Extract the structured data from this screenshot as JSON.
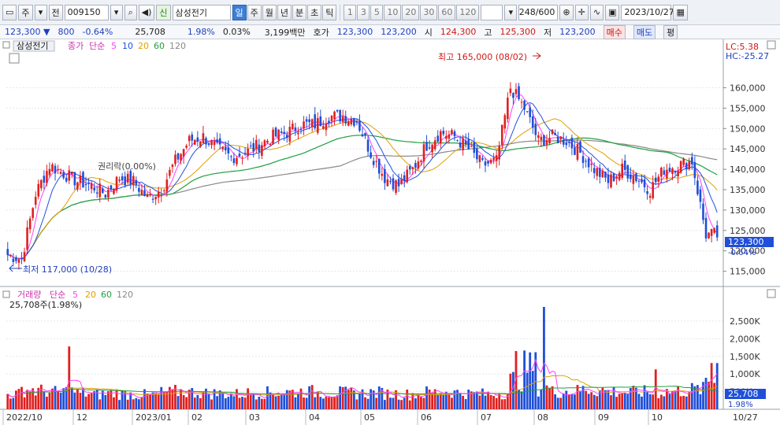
{
  "toolbar": {
    "market": "주",
    "period_prefix": "전",
    "stock_code": "009150",
    "credit_badge": "신",
    "stock_name": "삼성전기",
    "timeframes": [
      "일",
      "주",
      "월",
      "년",
      "분",
      "초",
      "틱"
    ],
    "active_timeframe": "일",
    "minute_options": [
      "1",
      "3",
      "5",
      "10",
      "20",
      "30",
      "60",
      "120"
    ],
    "count_display": "248/600",
    "date": "2023/10/27"
  },
  "quote": {
    "price": "123,300",
    "change_arrow": "▼",
    "change": "800",
    "change_pct": "-0.64%",
    "volume": "25,708",
    "volume_pct": "1.98%",
    "turnover": "0.03%",
    "amount": "3,199백만",
    "ask_label": "호가",
    "ask": "123,300",
    "bid": "123,200",
    "open_label": "시",
    "open": "124,300",
    "high_label": "고",
    "high": "125,300",
    "low_label": "저",
    "low": "123,200",
    "buy_label": "매수",
    "sell_label": "매도",
    "eval_label": "평"
  },
  "price_panel": {
    "title": "삼성전기",
    "ma_prefix": "종가",
    "ma_type": "단순",
    "ma_periods": [
      "5",
      "10",
      "20",
      "60",
      "120"
    ],
    "hl_high_label": "LC:5.38",
    "hl_low_label": "HC:-25.27",
    "annot_high": "최고 165,000 (08/02)",
    "annot_low": "최저 117,000 (10/28)",
    "annot_mid": "권리락(0.00%)",
    "last_price": "123,300",
    "last_pct": "-0.64%"
  },
  "volume_panel": {
    "title": "거래량",
    "ma_type": "단순",
    "ma_periods": [
      "5",
      "20",
      "60",
      "120"
    ],
    "current": "25,708주(1.98%)",
    "last_value": "25,708",
    "last_pct": "1.98%"
  },
  "colors": {
    "up": "#e02020",
    "down": "#1f4fd8",
    "ma5": "#ff40ff",
    "ma10": "#2050e0",
    "ma20": "#e0a000",
    "ma60": "#20a040",
    "ma120": "#888888"
  },
  "chart_data": {
    "type": "candlestick",
    "y_ticks": [
      "160,000",
      "155,000",
      "150,000",
      "145,000",
      "140,000",
      "135,000",
      "130,000",
      "125,000",
      "120,000",
      "115,000"
    ],
    "ylim": [
      113000,
      168000
    ],
    "vol_ticks": [
      "2,500K",
      "2,000K",
      "1,500K",
      "1,000K",
      "500K"
    ],
    "vol_ylim": [
      0,
      2900000
    ],
    "x_labels": [
      "2022/10",
      "12",
      "2023/01",
      "02",
      "03",
      "04",
      "05",
      "06",
      "07",
      "08",
      "09",
      "10",
      "10/27"
    ],
    "weekly_close": [
      119000,
      118000,
      134000,
      141000,
      139000,
      137000,
      136000,
      134000,
      138000,
      137000,
      133000,
      135000,
      142000,
      147000,
      148000,
      145000,
      143000,
      144000,
      146000,
      148000,
      149000,
      151000,
      151000,
      153000,
      153000,
      152000,
      144000,
      138000,
      136000,
      140000,
      146000,
      149000,
      148000,
      145000,
      141000,
      142000,
      160000,
      155000,
      147000,
      148000,
      147000,
      144000,
      140000,
      137000,
      140000,
      138000,
      135000,
      140000,
      141000,
      142000,
      124000
    ],
    "weekly_volume": [
      430000,
      560000,
      520000,
      480000,
      510000,
      450000,
      420000,
      460000,
      430000,
      410000,
      400000,
      470000,
      500000,
      480000,
      450000,
      440000,
      430000,
      460000,
      470000,
      480000,
      490000,
      500000,
      470000,
      480000,
      460000,
      450000,
      470000,
      440000,
      420000,
      430000,
      480000,
      500000,
      470000,
      440000,
      430000,
      460000,
      820000,
      1200000,
      600000,
      500000,
      520000,
      560000,
      540000,
      500000,
      480000,
      490000,
      470000,
      510000,
      520000,
      560000,
      800000
    ],
    "volume_spikes": [
      {
        "week": 4,
        "value": 1780000
      },
      {
        "week": 36,
        "value": 1650000
      },
      {
        "week": 38,
        "value": 2900000
      },
      {
        "week": 46,
        "value": 1130000
      },
      {
        "week": 50,
        "value": 1310000
      }
    ]
  }
}
